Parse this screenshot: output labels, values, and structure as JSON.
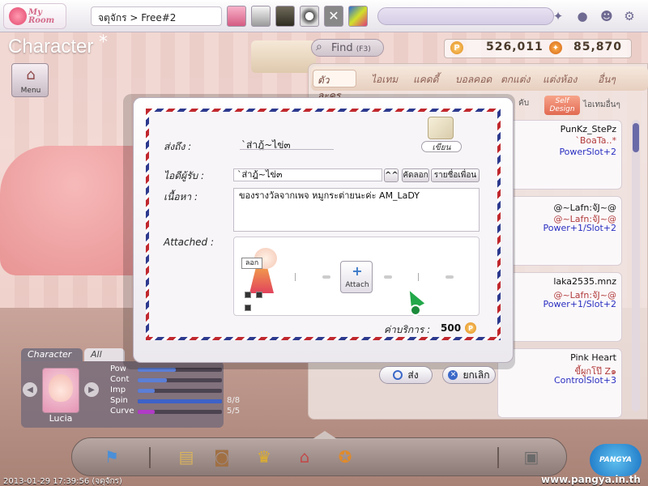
{
  "topbar": {
    "logo_text": "My Room",
    "channel": "จตุจักร > Free#2"
  },
  "left": {
    "title": "Character",
    "title_star": "*",
    "menu_label": "Menu"
  },
  "shop": {
    "find_label": "Find",
    "find_hint": "(F3)",
    "coin_p": "P",
    "points": "526,011",
    "pang": "85,870",
    "tabs": [
      "ตัวละคร",
      "ไอเทม",
      "แคดดี้",
      "บอลคอด",
      "ตกแต่ง",
      "แต่งห้อง",
      "อื่นๆ"
    ],
    "sub_tab_a": "คับ",
    "sub_tab_design": "Self Design",
    "sub_tab_b": "ไอเทมอื่นๆ",
    "cards": [
      {
        "name": "PunKz_StePz",
        "sub": "`BoaTa..*",
        "slot": "PowerSlot+2"
      },
      {
        "name": "@~Lafn:จัJ~@",
        "sub": "@~Lafn:จัJ~@",
        "slot": "Power+1/Slot+2"
      },
      {
        "name": "laka2535.mnz",
        "sub": "@~Lafn:จัJ~@",
        "slot": "Power+1/Slot+2"
      },
      {
        "name": "Pink Heart",
        "sub": "ขี้ผูกโป๊ Z๑",
        "slot": "ControlSlot+3"
      }
    ]
  },
  "stats": {
    "tab_character": "Character",
    "tab_all": "All",
    "char_name": "Lucia",
    "rows": [
      {
        "label": "Pow",
        "value": "",
        "fill": 0.45,
        "color": "#5b7ed6"
      },
      {
        "label": "Cont",
        "value": "",
        "fill": 0.35,
        "color": "#5b7ed6"
      },
      {
        "label": "Imp",
        "value": "",
        "fill": 0.2,
        "color": "#5b7ed6"
      },
      {
        "label": "Spin",
        "value": "8/8",
        "fill": 1.0,
        "color": "#3d62c8"
      },
      {
        "label": "Curve",
        "value": "5/5",
        "fill": 0.2,
        "color": "#b03cc6"
      }
    ]
  },
  "dialog": {
    "to_label": "ส่งถึง :",
    "to_value": "`ส่าฎ้~ไข่๓",
    "write_label": "เขียน",
    "recipient_label": "ไอดีผู้รับ :",
    "recipient_value": "`ส่าฎ้~ไข่๓",
    "carets": "^^",
    "copy_btn": "คัดลอก",
    "friend_list_btn": "รายชื่อเพื่อน",
    "content_label": "เนื้อหา :",
    "content_value": "ของรางวัลจากเพจ หมูกระต่ายนะค่ะ AM_LaDY",
    "attached_label": "Attached :",
    "item_tag": "ลอก",
    "attach_plus": "+",
    "attach_btn": "Attach",
    "fee_label": "ค่าบริการ :",
    "fee_value": "500",
    "fee_coin": "P",
    "send_btn": "ส่ง",
    "cancel_btn": "ยกเลิก"
  },
  "footer": {
    "timestamp": "2013-01-29 17:39:56 (จตุจักร)",
    "url": "www.pangya.in.th",
    "pangya_logo": "PANGYA"
  }
}
